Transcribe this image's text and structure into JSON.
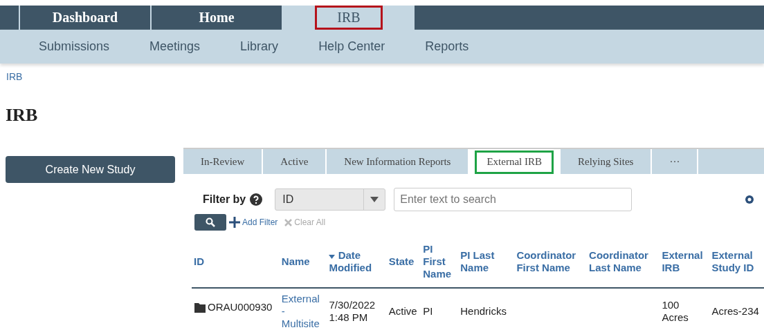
{
  "top_nav": [
    {
      "label": "Dashboard",
      "selected": false,
      "highlighted": false
    },
    {
      "label": "Home",
      "selected": false,
      "highlighted": false
    },
    {
      "label": "IRB",
      "selected": true,
      "highlighted": true
    }
  ],
  "sub_nav": [
    "Submissions",
    "Meetings",
    "Library",
    "Help Center",
    "Reports"
  ],
  "breadcrumb": "IRB",
  "page_title": "IRB",
  "create_button": "Create New Study",
  "tabs": [
    {
      "label": "In-Review",
      "selected": false,
      "highlighted": false
    },
    {
      "label": "Active",
      "selected": false,
      "highlighted": false
    },
    {
      "label": "New Information Reports",
      "selected": false,
      "highlighted": false
    },
    {
      "label": "External IRB",
      "selected": true,
      "highlighted": true
    },
    {
      "label": "Relying Sites",
      "selected": false,
      "highlighted": false
    },
    {
      "label": "···",
      "selected": false,
      "highlighted": false
    }
  ],
  "filter": {
    "label": "Filter by",
    "field": "ID",
    "placeholder": "Enter text to search",
    "add_filter": "Add Filter",
    "clear_all": "Clear All"
  },
  "table": {
    "columns": [
      {
        "label": "ID",
        "sorted": false
      },
      {
        "label": "Name",
        "sorted": false
      },
      {
        "label": "Date Modified",
        "sorted": true
      },
      {
        "label": "State",
        "sorted": false
      },
      {
        "label": "PI First Name",
        "sorted": false
      },
      {
        "label": "PI Last Name",
        "sorted": false
      },
      {
        "label": "Coordinator First Name",
        "sorted": false
      },
      {
        "label": "Coordinator Last Name",
        "sorted": false
      },
      {
        "label": "External IRB",
        "sorted": false
      },
      {
        "label": "External Study ID",
        "sorted": false
      }
    ],
    "rows": [
      {
        "cells": [
          "ORAU000930",
          "External - Multisite",
          "7/30/2022 1:48 PM",
          "Active",
          "PI",
          "Hendricks",
          "",
          "",
          "100 Acres",
          "Acres-234"
        ]
      }
    ]
  }
}
